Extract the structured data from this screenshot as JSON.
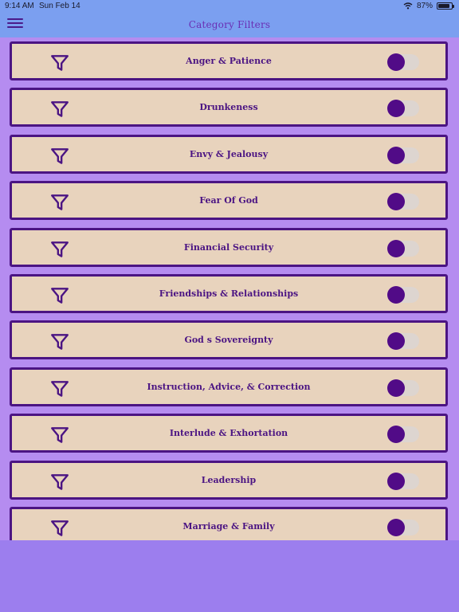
{
  "status_bar": {
    "time": "9:14 AM",
    "date": "Sun Feb 14",
    "battery_text": "87%",
    "battery_level": 0.87,
    "wifi_icon": "wifi-icon"
  },
  "nav": {
    "title": "Category Filters",
    "menu_icon": "hamburger-menu-icon"
  },
  "colors": {
    "nav_background": "#7b9ff0",
    "page_background": "#9c7eee",
    "row_background": "#e8d3bd",
    "row_border": "#4b1483",
    "toggle_knob": "#510b87"
  },
  "categories": [
    {
      "label": "Anger & Patience",
      "enabled": false
    },
    {
      "label": "Drunkeness",
      "enabled": false
    },
    {
      "label": "Envy & Jealousy",
      "enabled": false
    },
    {
      "label": "Fear Of God",
      "enabled": false
    },
    {
      "label": "Financial Security",
      "enabled": false
    },
    {
      "label": "Friendships & Relationships",
      "enabled": false
    },
    {
      "label": "God s Sovereignty",
      "enabled": false
    },
    {
      "label": "Instruction, Advice, & Correction",
      "enabled": false
    },
    {
      "label": "Interlude & Exhortation",
      "enabled": false
    },
    {
      "label": "Leadership",
      "enabled": false
    },
    {
      "label": "Marriage & Family",
      "enabled": false
    }
  ]
}
